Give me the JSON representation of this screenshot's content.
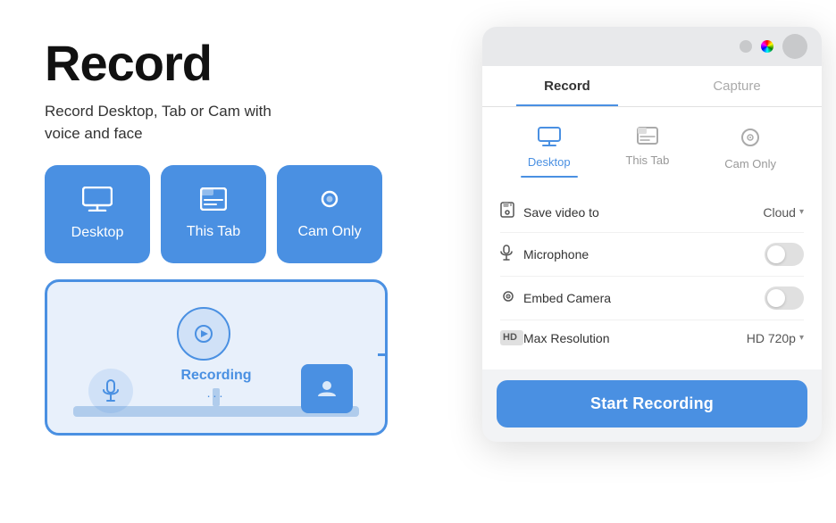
{
  "page": {
    "title": "Record",
    "subtitle_line1": "Record Desktop, Tab or Cam with",
    "subtitle_line2": "voice and face"
  },
  "option_buttons": [
    {
      "id": "desktop",
      "label": "Desktop",
      "icon": "🖥"
    },
    {
      "id": "this-tab",
      "label": "This Tab",
      "icon": "⬛"
    },
    {
      "id": "cam-only",
      "label": "Cam Only",
      "icon": "📷"
    }
  ],
  "preview": {
    "recording_label": "Recording",
    "recording_dots": "..."
  },
  "plugin": {
    "tabs": [
      {
        "id": "record",
        "label": "Record",
        "active": true
      },
      {
        "id": "capture",
        "label": "Capture",
        "active": false
      }
    ],
    "modes": [
      {
        "id": "desktop",
        "label": "Desktop",
        "active": true,
        "icon": "🖥"
      },
      {
        "id": "this-tab",
        "label": "This Tab",
        "active": false,
        "icon": "⬛"
      },
      {
        "id": "cam-only",
        "label": "Cam Only",
        "active": false,
        "icon": "⭕"
      }
    ],
    "settings": [
      {
        "id": "save-video",
        "label": "Save video to",
        "icon": "💾",
        "value": "Cloud",
        "type": "dropdown"
      },
      {
        "id": "microphone",
        "label": "Microphone",
        "icon": "🎙",
        "value": null,
        "type": "toggle",
        "enabled": false
      },
      {
        "id": "embed-camera",
        "label": "Embed Camera",
        "icon": "📷",
        "value": null,
        "type": "toggle",
        "enabled": false
      },
      {
        "id": "max-resolution",
        "label": "Max Resolution",
        "icon": "HD",
        "value": "HD 720p",
        "type": "dropdown"
      }
    ],
    "start_button_label": "Start Recording"
  }
}
